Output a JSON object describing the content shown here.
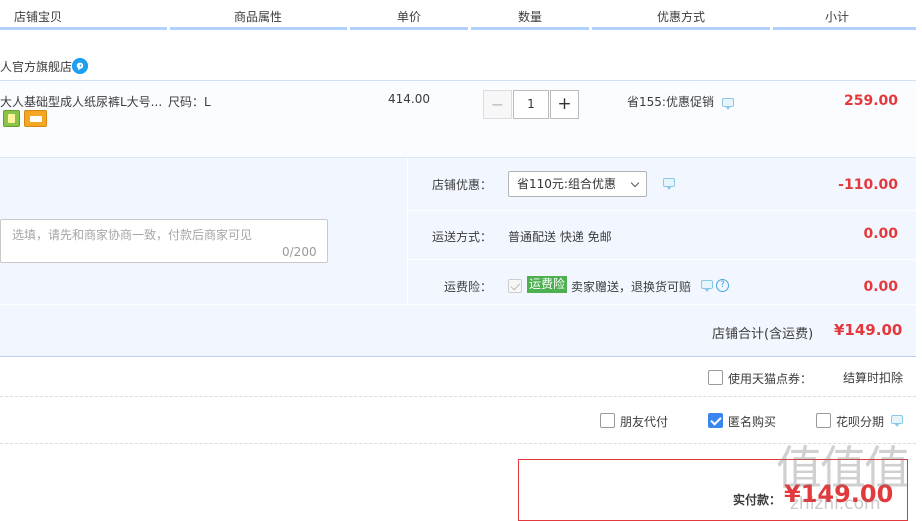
{
  "header": {
    "columns": [
      "店铺宝贝",
      "商品属性",
      "单价",
      "数量",
      "优惠方式",
      "小计"
    ]
  },
  "shop": {
    "name": "人官方旗舰店",
    "ww_icon": "chat-icon"
  },
  "item": {
    "title": "大人基础型成人纸尿裤L大号...",
    "attr": "尺码：L",
    "unit_price": "414.00",
    "quantity": "1",
    "qty_minus": "−",
    "qty_plus": "+",
    "promo": "省155:优惠促销",
    "subtotal": "259.00"
  },
  "shop_promo": {
    "label": "店铺优惠：",
    "selected": "省110元:组合优惠",
    "amount": "-110.00"
  },
  "memo": {
    "placeholder": "选填，请先和商家协商一致，付款后商家可见",
    "count": "0/200"
  },
  "shipping": {
    "label": "运送方式：",
    "value": "普通配送 快递 免邮",
    "amount": "0.00"
  },
  "insurance": {
    "label": "运费险：",
    "tag": "运费险",
    "desc": "卖家赠送，退换货可赔",
    "amount": "0.00"
  },
  "shop_total": {
    "label": "店铺合计(含运费)",
    "amount": "¥149.00"
  },
  "points": {
    "label": "使用天猫点券：",
    "note": "结算时扣除"
  },
  "options": {
    "friend_pay": "朋友代付",
    "anonymous": "匿名购买",
    "huabei": "花呗分期"
  },
  "payment": {
    "label": "实付款：",
    "amount": "¥149.00"
  },
  "watermark": {
    "text": "值值值",
    "sub": "zhizhi.com"
  },
  "colors": {
    "accent_red": "#e4393c",
    "header_line": "#b2d1ff",
    "shop_bg": "#f2f7ff",
    "checkbox_blue": "#3a86f0",
    "tag_green": "#4caf50"
  }
}
